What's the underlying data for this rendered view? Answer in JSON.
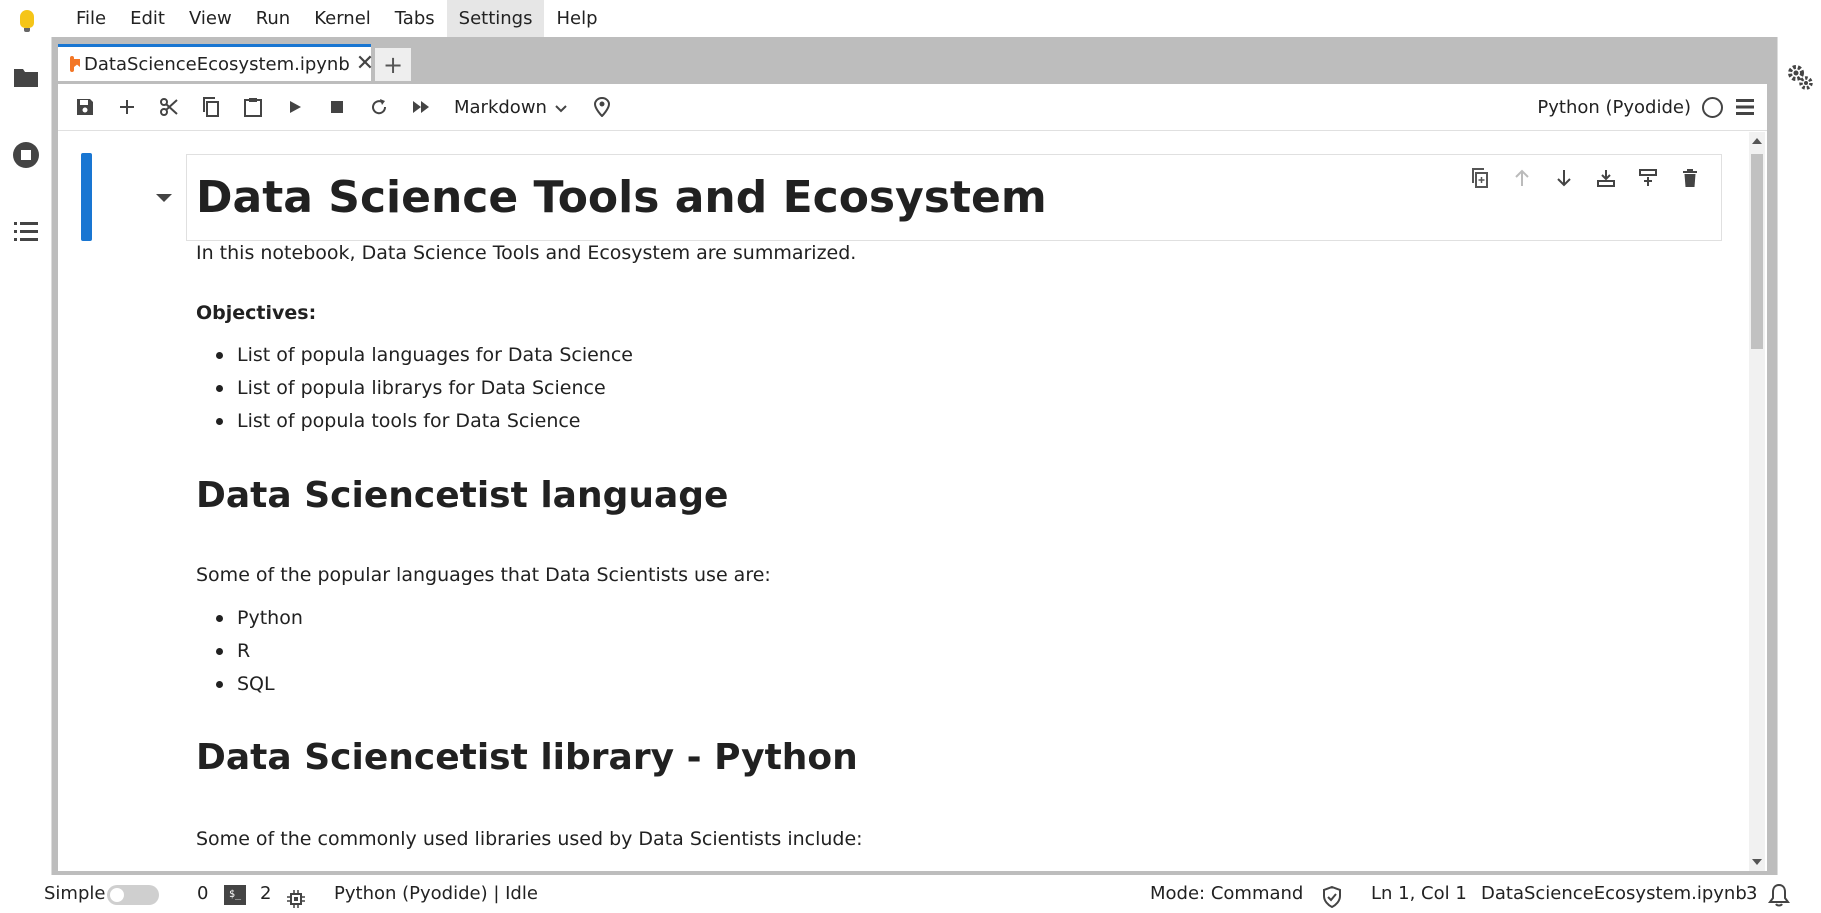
{
  "menubar": {
    "items": [
      "File",
      "Edit",
      "View",
      "Run",
      "Kernel",
      "Tabs",
      "Settings",
      "Help"
    ],
    "active_index": 6
  },
  "tab": {
    "title": "DataScienceEcosystem.ipynb",
    "close_glyph": "✕",
    "add_glyph": "+"
  },
  "toolbar": {
    "cell_type": "Markdown",
    "kernel_name": "Python (Pyodide)"
  },
  "notebook": {
    "title": "Data Science Tools and Ecosystem",
    "intro": "In this notebook, Data Science Tools and Ecosystem are summarized.",
    "objectives_label": "Objectives:",
    "objectives": [
      "List of popula languages for Data Science",
      "List of popula librarys for Data Science",
      "List of popula tools for Data Science"
    ],
    "languages_heading": "Data Sciencetist language",
    "languages_intro": "Some of the popular languages that Data Scientists use are:",
    "languages": [
      "Python",
      "R",
      "SQL"
    ],
    "libraries_heading": "Data Sciencetist library - Python",
    "libraries_intro": "Some of the commonly used libraries used by Data Scientists include:"
  },
  "statusbar": {
    "mode_label": "Simple",
    "counter_a": "0",
    "terminal_glyph": "$_",
    "counter_b": "2",
    "kernel_status": "Python (Pyodide) | Idle",
    "command_mode": "Mode: Command",
    "cursor": "Ln 1, Col 1",
    "filename": "DataScienceEcosystem.ipynb",
    "notifications": "3"
  },
  "colors": {
    "accent": "#1976d2",
    "notebook_icon": "#f37626",
    "logo": "#f5c518"
  }
}
